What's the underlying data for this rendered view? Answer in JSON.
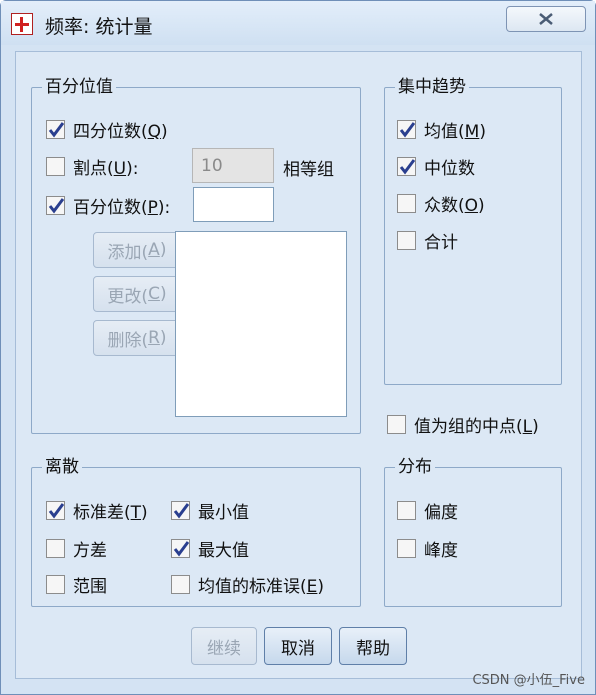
{
  "window": {
    "title": "频率: 统计量"
  },
  "percentile_values": {
    "legend": "百分位值",
    "quartiles": {
      "text": "四分位数(",
      "mnemonic": "Q",
      "tail": ")",
      "checked": true
    },
    "cut_points": {
      "text": "割点(",
      "mnemonic": "U",
      "tail": "):",
      "checked": false,
      "value": "10",
      "suffix": "相等组"
    },
    "percentiles": {
      "text": "百分位数(",
      "mnemonic": "P",
      "tail": "):",
      "checked": true,
      "value": ""
    },
    "buttons": [
      {
        "text": "添加(",
        "mnemonic": "A",
        "tail": ")"
      },
      {
        "text": "更改(",
        "mnemonic": "C",
        "tail": ")"
      },
      {
        "text": "删除(",
        "mnemonic": "R",
        "tail": ")"
      }
    ]
  },
  "central_tendency": {
    "legend": "集中趋势",
    "items": [
      {
        "text": "均值(",
        "mnemonic": "M",
        "tail": ")",
        "checked": true
      },
      {
        "text": "中位数",
        "mnemonic": "",
        "tail": "",
        "checked": true
      },
      {
        "text": "众数(",
        "mnemonic": "O",
        "tail": ")",
        "checked": false
      },
      {
        "text": "合计",
        "mnemonic": "",
        "tail": "",
        "checked": false
      }
    ]
  },
  "group_midpoints": {
    "text": "值为组的中点(",
    "mnemonic": "L",
    "tail": ")",
    "checked": false
  },
  "dispersion": {
    "legend": "离散",
    "std_dev": {
      "text": "标准差(",
      "mnemonic": "T",
      "tail": ")",
      "checked": true
    },
    "variance": {
      "text": "方差",
      "checked": false
    },
    "range": {
      "text": "范围",
      "checked": false
    },
    "minimum": {
      "text": "最小值",
      "checked": true
    },
    "maximum": {
      "text": "最大值",
      "checked": true
    },
    "se_mean": {
      "text": "均值的标准误(",
      "mnemonic": "E",
      "tail": ")",
      "checked": false
    }
  },
  "distribution": {
    "legend": "分布",
    "skewness": {
      "text": "偏度",
      "checked": false
    },
    "kurtosis": {
      "text": "峰度",
      "checked": false
    }
  },
  "footer": {
    "continue": "继续",
    "cancel": "取消",
    "help": "帮助"
  },
  "watermark": "CSDN @小伍_Five",
  "colors": {
    "check": "#2a3f8f",
    "frame": "#8ea9c8",
    "background": "#dce8f5"
  }
}
